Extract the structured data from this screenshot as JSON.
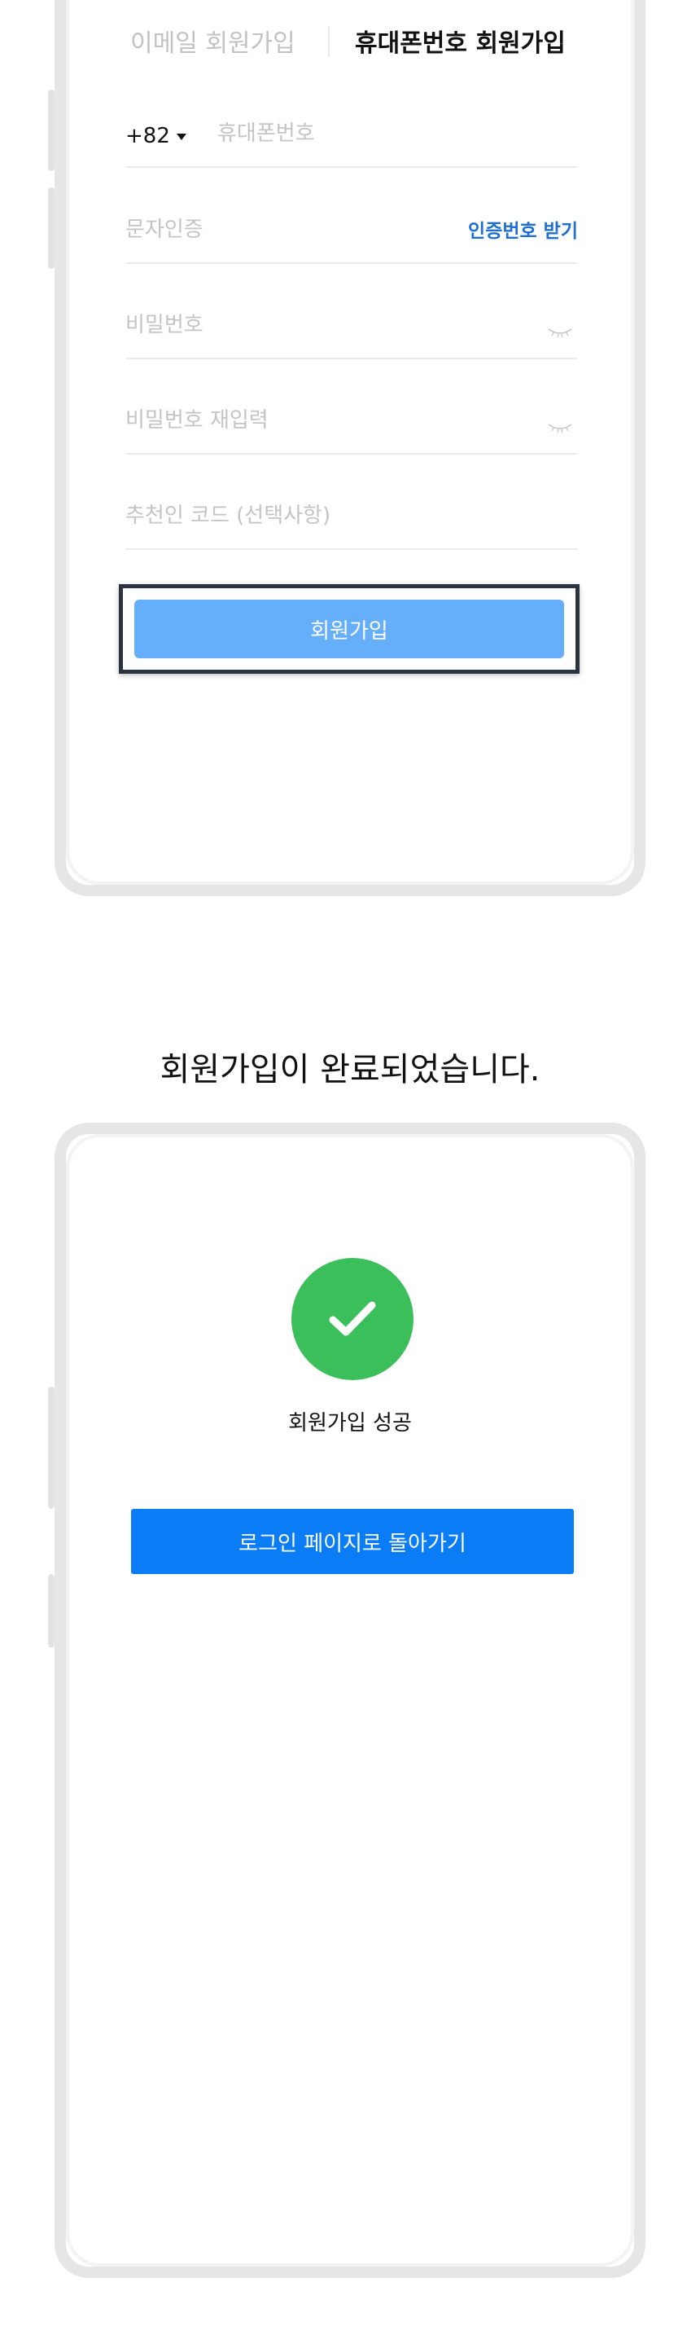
{
  "signup": {
    "tab_email": "이메일 회원가입",
    "tab_phone": "휴대폰번호 회원가입",
    "country_code": "+82",
    "phone_placeholder": "휴대폰번호",
    "sms_placeholder": "문자인증",
    "sms_button": "인증번호 받기",
    "password_placeholder": "비밀번호",
    "password_confirm_placeholder": "비밀번호 재입력",
    "referral_placeholder": "추천인 코드 (선택사항)",
    "submit_label": "회원가입"
  },
  "caption": "회원가입이 완료되었습니다.",
  "success": {
    "message": "회원가입 성공",
    "back_button": "로그인 페이지로 돌아가기"
  },
  "colors": {
    "accent": "#0a7df6",
    "submit_disabled": "#65aef9",
    "success": "#3bbf5a",
    "link": "#1e6fd0"
  },
  "icons": {
    "country_caret": "chevron-down-icon",
    "password_toggle": "eye-closed-icon",
    "success": "checkmark-icon"
  }
}
